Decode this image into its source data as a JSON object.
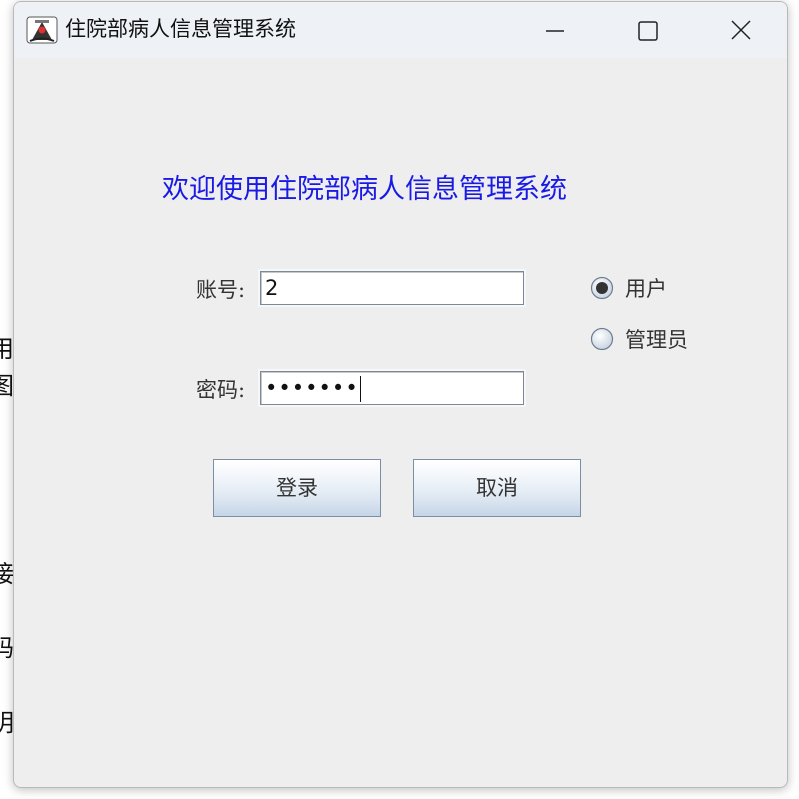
{
  "background": {
    "fragments": [
      "用",
      "图",
      "接",
      "码",
      "明"
    ]
  },
  "window": {
    "title": "住院部病人信息管理系统",
    "icon": "java-app-icon",
    "controls": [
      "minimize-icon",
      "maximize-icon",
      "close-icon"
    ]
  },
  "login": {
    "welcome_text": "欢迎使用住院部病人信息管理系统",
    "account_label": "账号:",
    "account_value": "2",
    "password_label": "密码:",
    "password_masked": "•••••••",
    "role_options": [
      {
        "label": "用户",
        "selected": true
      },
      {
        "label": "管理员",
        "selected": false
      }
    ],
    "login_button": "登录",
    "cancel_button": "取消"
  },
  "colors": {
    "welcome_text": "#1a1ae6",
    "window_background": "#eeeeee",
    "titlebar_background": "#eef2f7"
  }
}
